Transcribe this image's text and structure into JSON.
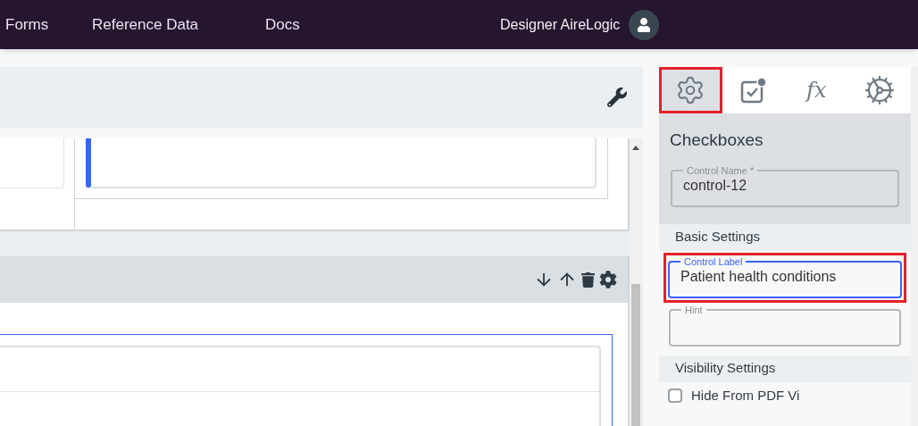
{
  "nav": {
    "items": [
      {
        "label": "Forms"
      },
      {
        "label": "Reference Data"
      },
      {
        "label": "Docs"
      }
    ],
    "user": "Designer AireLogic"
  },
  "panel": {
    "tabs": [
      {
        "selected": true
      },
      {
        "selected": false
      },
      {
        "label": "fx",
        "selected": false
      },
      {
        "selected": false
      }
    ],
    "title": "Checkboxes",
    "name_field": {
      "label": "Control Name *",
      "value": "control-12",
      "focused": false
    },
    "sections": [
      {
        "title": "Basic Settings",
        "fields": [
          {
            "label": "Control Label",
            "value": "Patient health conditions",
            "focused": true
          },
          {
            "label": "Hint",
            "focused": false
          }
        ]
      },
      {
        "title": "Visibility Settings",
        "checkboxes": [
          {
            "label": "Hide From PDF Vi",
            "checked": false
          }
        ]
      }
    ]
  }
}
